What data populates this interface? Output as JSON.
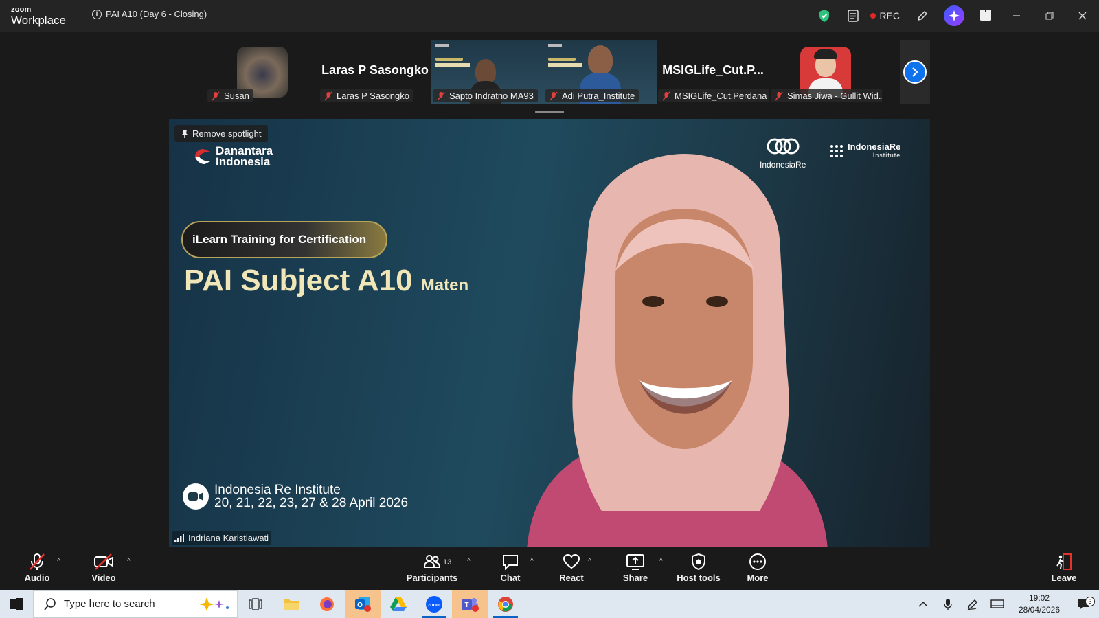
{
  "titlebar": {
    "brand_top": "zoom",
    "brand_bottom": "Workplace",
    "meeting_title": "PAI A10 (Day 6 - Closing)",
    "rec_label": "REC",
    "accent_ai": "#5b3bff",
    "shield_color": "#2ec27e"
  },
  "thumbnails": [
    {
      "name": "Susan",
      "kind": "photo"
    },
    {
      "name": "Laras P Sasongko",
      "kind": "text",
      "display": "Laras P Sasongko"
    },
    {
      "name": "Sapto Indratno MA93",
      "kind": "video"
    },
    {
      "name": "Adi Putra_Institute",
      "kind": "video"
    },
    {
      "name": "MSIGLife_Cut.Perdana",
      "kind": "text",
      "display": "MSIGLife_Cut.P..."
    },
    {
      "name": "Simas Jiwa - Gullit Wid...",
      "kind": "photo"
    }
  ],
  "main": {
    "spotlight_label": "Remove spotlight",
    "logo_left_line1": "Danantara",
    "logo_left_line2": "Indonesia",
    "logo_right1": "IndonesiaRe",
    "logo_right2": "IndonesiaRe",
    "logo_right2_sub": "Institute",
    "badge": "iLearn Training for Certification",
    "slide_title": "PAI Subject A10",
    "slide_title_suffix": "Maten",
    "footer_line1": "Indonesia Re Institute",
    "footer_line2": "20, 21, 22, 23, 27 & 28 April 2026",
    "speaker_name": "Indriana Karistiawati"
  },
  "controls": {
    "audio": "Audio",
    "video": "Video",
    "participants": "Participants",
    "participants_count": "13",
    "chat": "Chat",
    "react": "React",
    "share": "Share",
    "host_tools": "Host tools",
    "more": "More",
    "leave": "Leave"
  },
  "taskbar": {
    "search_placeholder": "Type here to search",
    "time": "19:02",
    "date": "28/04/2026",
    "notif_count": "3"
  }
}
